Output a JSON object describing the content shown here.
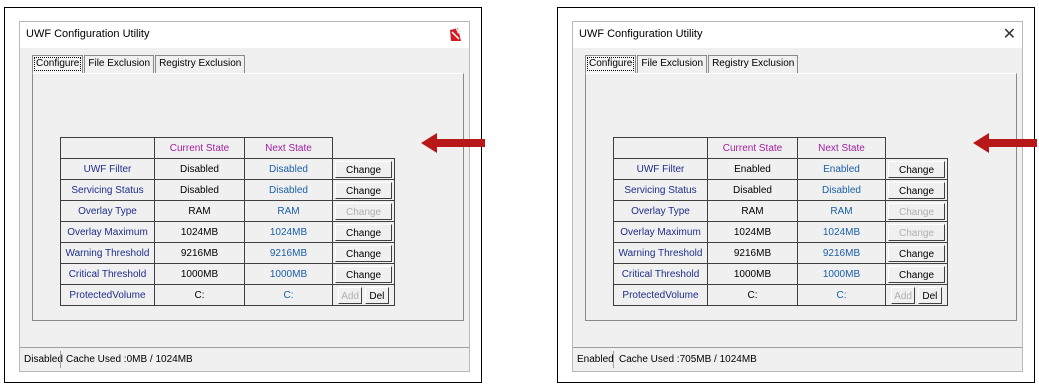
{
  "accent": {
    "arrow": "#b81818",
    "header": "#a01fa0",
    "label": "#1e2e8a",
    "next": "#1a5fa8"
  },
  "panels": [
    {
      "title": "UWF Configuration Utility",
      "close_icon": "red-close-icon",
      "tabs": [
        "Configure",
        "File Exclusion",
        "Registry Exclusion"
      ],
      "headers": [
        "Current State",
        "Next State"
      ],
      "rows": [
        {
          "label": "UWF Filter",
          "current": "Disabled",
          "next": "Disabled",
          "button": "Change",
          "enabled": true
        },
        {
          "label": "Servicing Status",
          "current": "Disabled",
          "next": "Disabled",
          "button": "Change",
          "enabled": true
        },
        {
          "label": "Overlay Type",
          "current": "RAM",
          "next": "RAM",
          "button": "Change",
          "enabled": false
        },
        {
          "label": "Overlay Maximum",
          "current": "1024MB",
          "next": "1024MB",
          "button": "Change",
          "enabled": true
        },
        {
          "label": "Warning Threshold",
          "current": "9216MB",
          "next": "9216MB",
          "button": "Change",
          "enabled": true
        },
        {
          "label": "Critical Threshold",
          "current": "1000MB",
          "next": "1000MB",
          "button": "Change",
          "enabled": true
        }
      ],
      "protected": {
        "label": "ProtectedVolume",
        "current": "C:",
        "next": "C:",
        "add": "Add",
        "del": "Del"
      },
      "status": {
        "state": "Disabled",
        "cache": "Cache Used :0MB / 1024MB"
      }
    },
    {
      "title": "UWF Configuration Utility",
      "close_icon": "close-icon",
      "close_glyph": "✕",
      "tabs": [
        "Configure",
        "File Exclusion",
        "Registry Exclusion"
      ],
      "headers": [
        "Current State",
        "Next State"
      ],
      "rows": [
        {
          "label": "UWF Filter",
          "current": "Enabled",
          "next": "Enabled",
          "button": "Change",
          "enabled": true
        },
        {
          "label": "Servicing Status",
          "current": "Disabled",
          "next": "Disabled",
          "button": "Change",
          "enabled": true
        },
        {
          "label": "Overlay Type",
          "current": "RAM",
          "next": "RAM",
          "button": "Change",
          "enabled": false
        },
        {
          "label": "Overlay Maximum",
          "current": "1024MB",
          "next": "1024MB",
          "button": "Change",
          "enabled": false
        },
        {
          "label": "Warning Threshold",
          "current": "9216MB",
          "next": "9216MB",
          "button": "Change",
          "enabled": true
        },
        {
          "label": "Critical Threshold",
          "current": "1000MB",
          "next": "1000MB",
          "button": "Change",
          "enabled": true
        }
      ],
      "protected": {
        "label": "ProtectedVolume",
        "current": "C:",
        "next": "C:",
        "add": "Add",
        "del": "Del"
      },
      "status": {
        "state": "Enabled",
        "cache": "Cache Used :705MB / 1024MB"
      }
    }
  ]
}
